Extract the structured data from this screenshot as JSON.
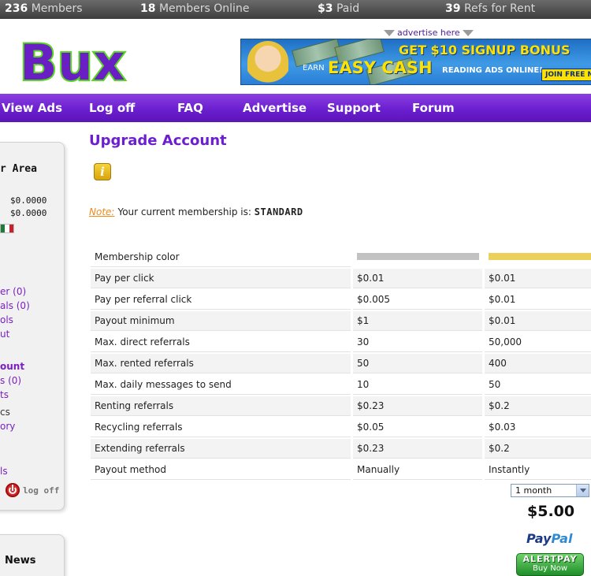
{
  "stats": [
    {
      "value": "236",
      "label": "Members"
    },
    {
      "value": "18",
      "label": "Members Online"
    },
    {
      "value": "$3",
      "label": "Paid"
    },
    {
      "value": "39",
      "label": "Refs for Rent"
    }
  ],
  "header": {
    "logo_text": ". Bux",
    "advertise_link": "advertise here",
    "banner": {
      "signup": "GET $10 SIGNUP BONUS",
      "earn": "EARN",
      "easy_cash": "EASY CASH",
      "reading": "READING ADS ONLINE!",
      "join": "JOIN FREE NO"
    }
  },
  "nav": [
    "View Ads",
    "Log off",
    "FAQ",
    "Advertise",
    "Support",
    "Forum"
  ],
  "sidebar": {
    "title": "r Area",
    "balance_1": "$0.0000",
    "balance_2": "$0.0000",
    "flag_colors": [
      "#1f7a3a",
      "#ffffff",
      "#c8202a"
    ],
    "links": [
      {
        "text": "er (0)",
        "style": "link"
      },
      {
        "text": "als (0)",
        "style": "link"
      },
      {
        "text": "ols",
        "style": "link"
      },
      {
        "text": "ut",
        "style": "link"
      },
      {
        "text": "ount",
        "style": "bold"
      },
      {
        "text": "s (0)",
        "style": "link"
      },
      {
        "text": "ts",
        "style": "link"
      },
      {
        "text": "cs",
        "style": "dark"
      },
      {
        "text": "ory",
        "style": "link"
      },
      {
        "text": "ls",
        "style": "link"
      }
    ],
    "logoff": "log off",
    "news_title": "News"
  },
  "main": {
    "title": "Upgrade Account",
    "note_label": "Note:",
    "note_text": "Your current membership is:",
    "note_value": "STANDARD",
    "color_row_label": "Membership color",
    "colors": {
      "standard": "#c2c2c2",
      "gold": "#ecd05c"
    },
    "rows": [
      {
        "label": "Pay per click",
        "standard": "$0.01",
        "gold": "$0.01"
      },
      {
        "label": "Pay per referral click",
        "standard": "$0.005",
        "gold": "$0.01"
      },
      {
        "label": "Payout minimum",
        "standard": "$1",
        "gold": "$0.01"
      },
      {
        "label": "Max. direct referrals",
        "standard": "30",
        "gold": "50,000"
      },
      {
        "label": "Max. rented referrals",
        "standard": "50",
        "gold": "400"
      },
      {
        "label": "Max. daily messages to send",
        "standard": "10",
        "gold": "50"
      },
      {
        "label": "Renting referrals",
        "standard": "$0.23",
        "gold": "$0.2"
      },
      {
        "label": "Recycling referrals",
        "standard": "$0.05",
        "gold": "$0.03"
      },
      {
        "label": "Extending referrals",
        "standard": "$0.23",
        "gold": "$0.2"
      },
      {
        "label": "Payout method",
        "standard": "Manually",
        "gold": "Instantly"
      }
    ],
    "period_selected": "1 month",
    "price": "$5.00",
    "paypal_a": "Pay",
    "paypal_b": "Pal",
    "alertpay_a": "ALERTPAY",
    "alertpay_b": "Buy Now"
  }
}
